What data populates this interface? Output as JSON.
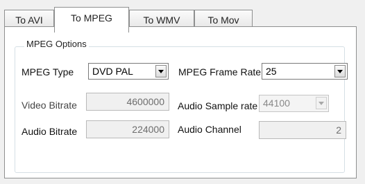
{
  "tabs": [
    {
      "label": "To AVI"
    },
    {
      "label": "To MPEG"
    },
    {
      "label": "To WMV"
    },
    {
      "label": "To Mov"
    }
  ],
  "active_tab": "To MPEG",
  "group": {
    "title": "MPEG Options"
  },
  "form": {
    "mpeg_type_label": "MPEG Type",
    "mpeg_type_value": "DVD PAL",
    "frame_rate_label": "MPEG Frame Rate",
    "frame_rate_value": "25",
    "video_bitrate_label": "Video Bitrate",
    "video_bitrate_value": "4600000",
    "audio_sample_rate_label": "Audio Sample rate",
    "audio_sample_rate_value": "44100",
    "audio_bitrate_label": "Audio Bitrate",
    "audio_bitrate_value": "224000",
    "audio_channel_label": "Audio Channel",
    "audio_channel_value": "2"
  },
  "icons": {
    "dropdown": "chevron-down-icon"
  }
}
